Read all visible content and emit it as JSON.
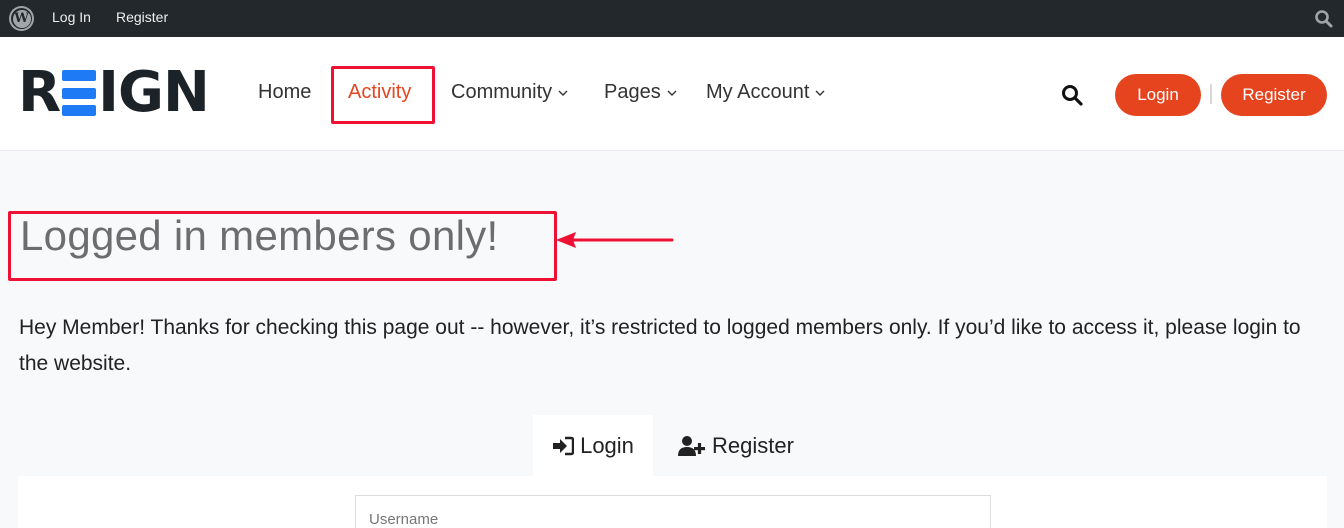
{
  "adminbar": {
    "wp_logo_icon": "wordpress-icon",
    "links": [
      "Log In",
      "Register"
    ],
    "search_icon": "search-icon"
  },
  "header": {
    "logo": {
      "letters": [
        "R",
        "E",
        "I",
        "G",
        "N"
      ],
      "accent_color": "#1f7bf5"
    },
    "nav": [
      {
        "label": "Home",
        "dropdown": false
      },
      {
        "label": "Activity",
        "dropdown": false,
        "active": true
      },
      {
        "label": "Community",
        "dropdown": true
      },
      {
        "label": "Pages",
        "dropdown": true
      },
      {
        "label": "My Account",
        "dropdown": true
      }
    ],
    "search_icon": "search-icon",
    "login_button": "Login",
    "register_button": "Register",
    "button_color": "#e5441e"
  },
  "main": {
    "title": "Logged in members only!",
    "intro": "Hey Member! Thanks for checking this page out -- however, it’s restricted to logged members only. If you’d like to access it, please login to the website.",
    "tabs": [
      {
        "label": "Login",
        "icon": "sign-in-icon",
        "active": true
      },
      {
        "label": "Register",
        "icon": "user-plus-icon",
        "active": false
      }
    ],
    "username_placeholder": "Username"
  },
  "annotations": {
    "highlight_color": "#ee1133"
  }
}
